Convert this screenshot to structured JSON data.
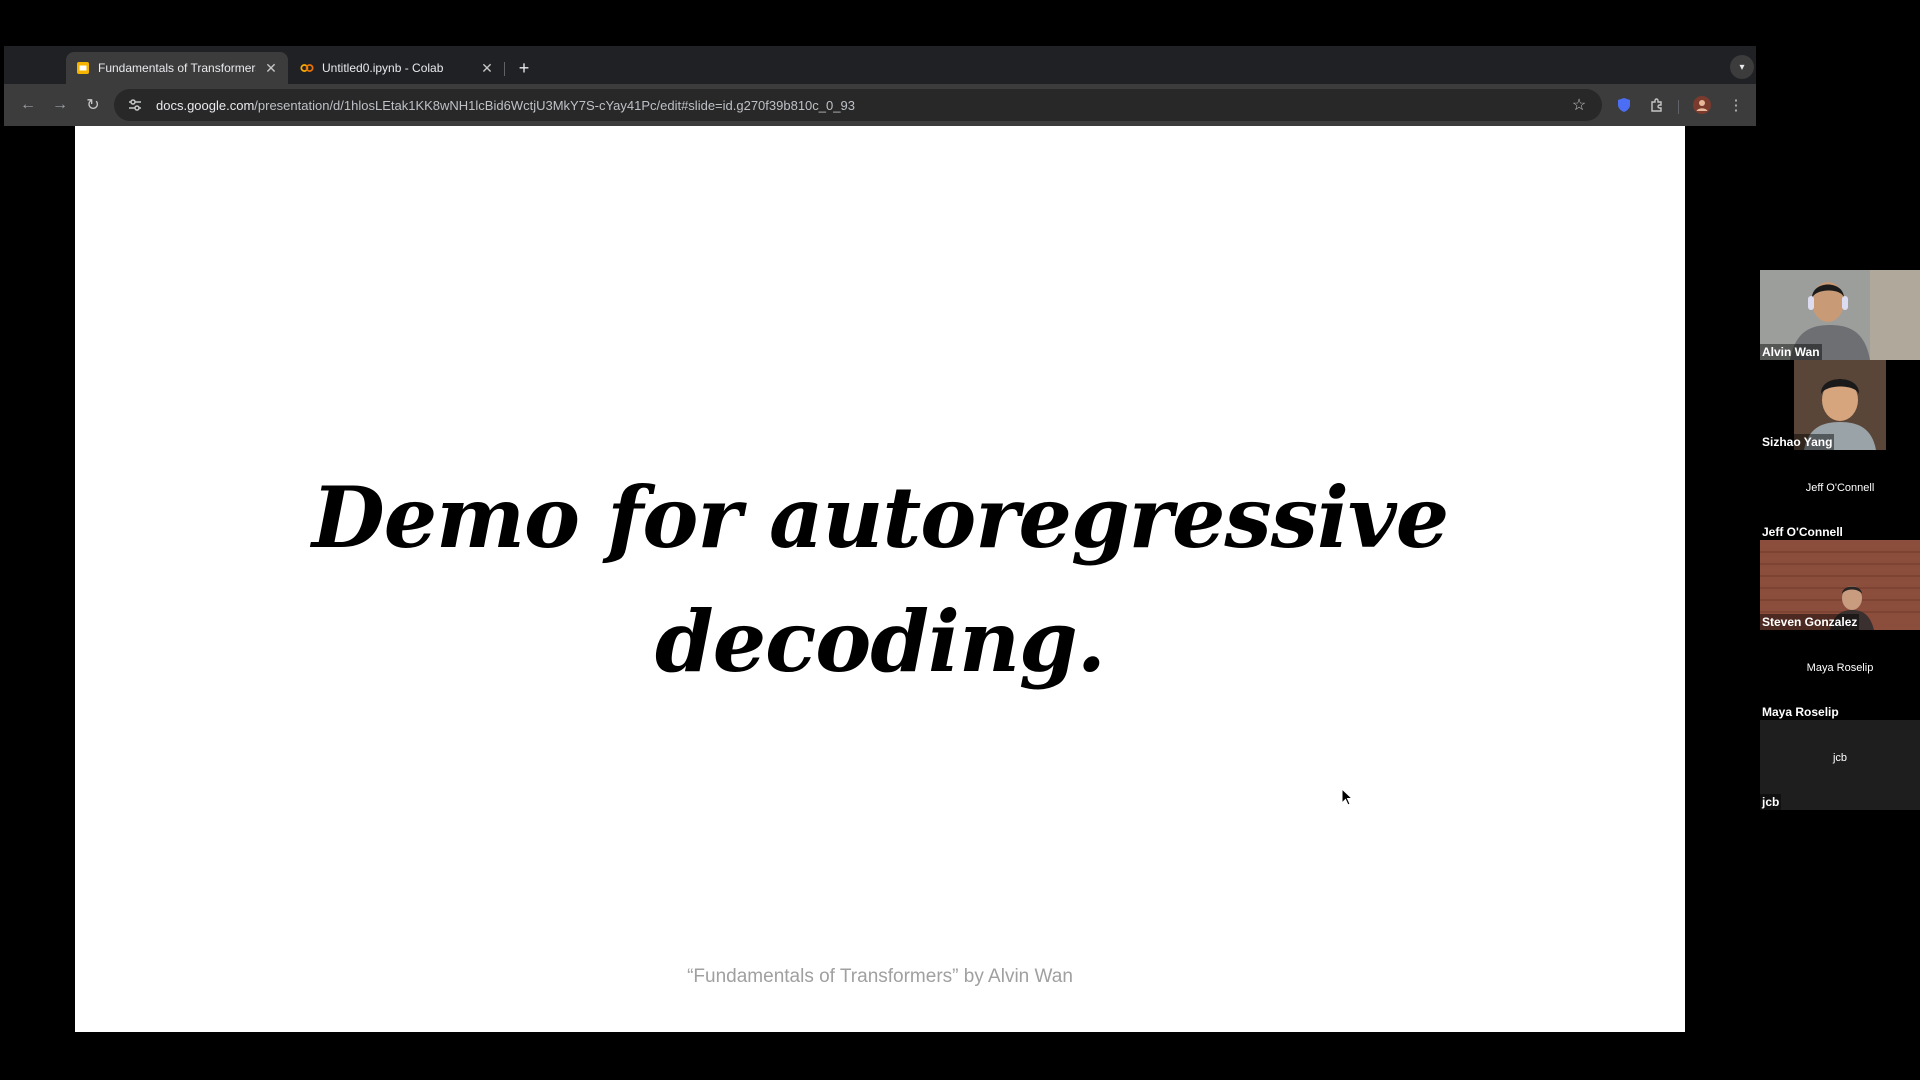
{
  "browser": {
    "tabs": [
      {
        "title": "Fundamentals of Transformers",
        "active": true,
        "icon": "slides-icon"
      },
      {
        "title": "Untitled0.ipynb - Colab",
        "active": false,
        "icon": "colab-icon"
      }
    ],
    "new_tab_label": "+",
    "url_host": "docs.google.com",
    "url_path": "/presentation/d/1hlosLEtak1KK8wNH1lcBid6WctjU3MkY7S-cYay41Pc/edit#slide=id.g270f39b810c_0_93"
  },
  "slide": {
    "title_line1": "Demo for autoregressive",
    "title_line2": "decoding.",
    "footer": "“Fundamentals of Transformers” by Alvin Wan"
  },
  "participants": [
    {
      "name": "Alvin Wan",
      "video": true,
      "center_label": ""
    },
    {
      "name": "Sizhao Yang",
      "video": true,
      "center_label": ""
    },
    {
      "name": "Jeff O'Connell",
      "video": false,
      "center_label": "Jeff O'Connell"
    },
    {
      "name": "Steven Gonzalez",
      "video": true,
      "center_label": ""
    },
    {
      "name": "Maya Roselip",
      "video": false,
      "center_label": "Maya Roselip"
    },
    {
      "name": "jcb",
      "video": false,
      "center_label": "jcb"
    }
  ],
  "colors": {
    "accent_slides": "#f4b400",
    "accent_colab": "#f9ab00",
    "toolbar": "#3c3c3c",
    "tabstrip": "#202124"
  }
}
